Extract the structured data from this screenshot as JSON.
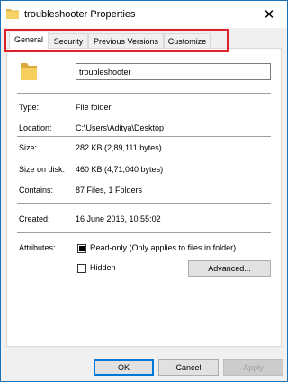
{
  "window": {
    "title": "troubleshooter Properties",
    "close_glyph": "✕"
  },
  "tabs": [
    {
      "label": "General",
      "active": true
    },
    {
      "label": "Security",
      "active": false
    },
    {
      "label": "Previous Versions",
      "active": false
    },
    {
      "label": "Customize",
      "active": false
    }
  ],
  "highlight_color": "#e0212a",
  "icon": {
    "name": "folder-icon",
    "color": "#f2c94c"
  },
  "name_field": {
    "value": "troubleshooter"
  },
  "properties": {
    "type": {
      "label": "Type:",
      "value": "File folder"
    },
    "location": {
      "label": "Location:",
      "value": "C:\\Users\\Aditya\\Desktop"
    },
    "size": {
      "label": "Size:",
      "value": "282 KB (2,89,111 bytes)"
    },
    "size_on_disk": {
      "label": "Size on disk:",
      "value": "460 KB (4,71,040 bytes)"
    },
    "contains": {
      "label": "Contains:",
      "value": "87 Files, 1 Folders"
    },
    "created": {
      "label": "Created:",
      "value": "16 June 2016, 10:55:02"
    }
  },
  "attributes": {
    "label": "Attributes:",
    "read_only": {
      "label": "Read-only (Only applies to files in folder)",
      "checked": true
    },
    "hidden": {
      "label": "Hidden",
      "checked": false
    },
    "advanced_button": "Advanced..."
  },
  "buttons": {
    "ok": "OK",
    "cancel": "Cancel",
    "apply": "Apply"
  }
}
